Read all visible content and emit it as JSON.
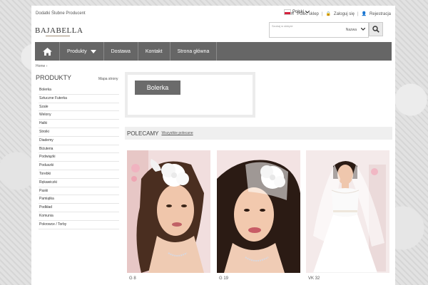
{
  "header": {
    "tagline": "Dodatki Ślubne Producent",
    "language": "Polski",
    "links": [
      "Poleć sklep",
      "Zaloguj się",
      "Rejestracja"
    ],
    "logo": "BAJABELLA",
    "search_placeholder": "Szukaj w sklepie",
    "search_scope": "Nazwa"
  },
  "nav": {
    "items": [
      "Produkty",
      "Dostawa",
      "Kontakt",
      "Strona główna"
    ]
  },
  "breadcrumb": "Home ›",
  "sidebar": {
    "title": "PRODUKTY",
    "sitemap": "Mapa strony",
    "categories": [
      "Bolerka",
      "Sztuczne Futerka",
      "Szale",
      "Welony",
      "Halki",
      "Stroiki",
      "Diademy",
      "Biżuteria",
      "Podwiązki",
      "Poduszki",
      "Torebki",
      "Rękawiczki",
      "Paski",
      "Pamiątka",
      "Podkład",
      "Komunia",
      "Pokrowce / Torby"
    ]
  },
  "category": {
    "title": "Bolerka"
  },
  "recommended": {
    "title": "POLECAMY",
    "link": "Wszystkie polecane",
    "products": [
      {
        "name": "G 8",
        "icon": "bride-headpiece-photo"
      },
      {
        "name": "G 19",
        "icon": "bride-veil-photo"
      },
      {
        "name": "VK 32",
        "icon": "bride-dress-photo"
      }
    ]
  },
  "colors": {
    "nav": "#666666",
    "page": "#ffffff",
    "background": "#dcdcdc"
  }
}
